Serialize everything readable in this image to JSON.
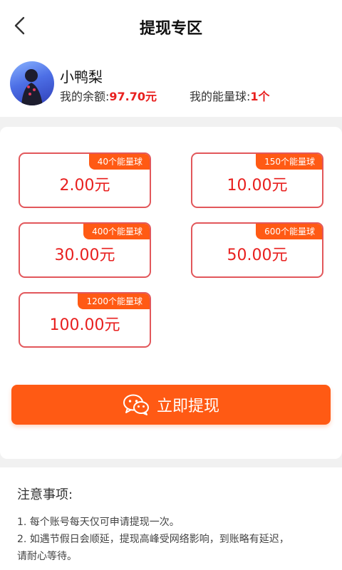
{
  "header": {
    "title": "提现专区"
  },
  "profile": {
    "name": "小鸭梨",
    "balance_label": "我的余额:",
    "balance_value": "97.70元",
    "energy_label": "我的能量球:",
    "energy_value": "1个"
  },
  "options": [
    {
      "cost": "40个能量球",
      "amount": "2.00元"
    },
    {
      "cost": "150个能量球",
      "amount": "10.00元"
    },
    {
      "cost": "400个能量球",
      "amount": "30.00元"
    },
    {
      "cost": "600个能量球",
      "amount": "50.00元"
    },
    {
      "cost": "1200个能量球",
      "amount": "100.00元"
    }
  ],
  "withdraw_button": {
    "label": "立即提现",
    "icon": "wechat-icon"
  },
  "notes": {
    "title": "注意事项:",
    "items": [
      "1. 每个账号每天仅可申请提现一次。",
      "2. 如遇节假日会顺延，提现高峰受网络影响，到账略有延迟，",
      "请耐心等待。"
    ]
  },
  "colors": {
    "accent": "#ff5a14",
    "amount": "#e8201f",
    "border": "#e2575b"
  }
}
